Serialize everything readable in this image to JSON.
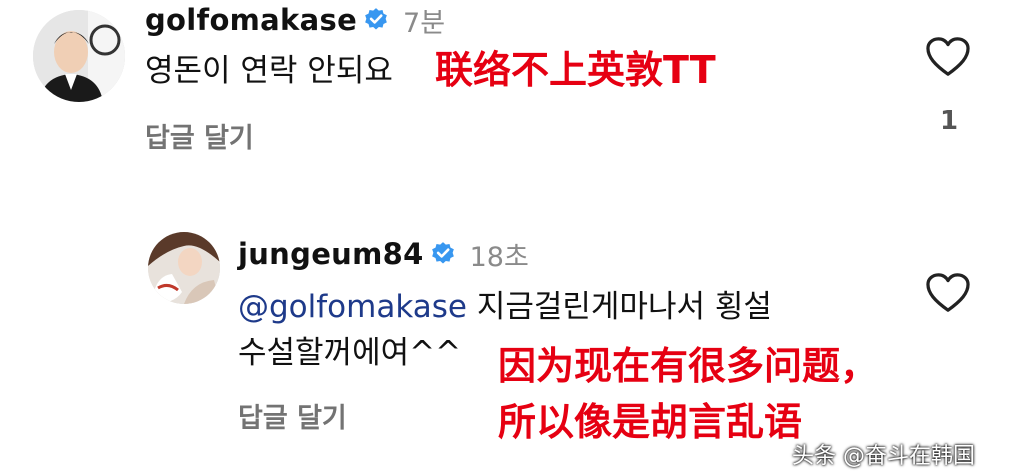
{
  "comments": [
    {
      "username": "golfomakase",
      "time": "7분",
      "text": "영돈이 연락 안되요",
      "reply_label": "답글 달기",
      "likes": "1",
      "annotation": "联络不上英敦TT"
    },
    {
      "username": "jungeum84",
      "time": "18초",
      "mention": "@golfomakase",
      "text_line1": " 지금걸린게마나서 횡설",
      "text_line2": "수설할꺼에여^^",
      "reply_label": "답글 달기",
      "annotation_line1": "因为现在有很多问题，",
      "annotation_line2": "所以像是胡言乱语"
    }
  ],
  "watermark": "头条 @奋斗在韩国",
  "colors": {
    "annotation": "#e60012",
    "verified": "#3897f0",
    "mention": "#1e3a8a"
  }
}
